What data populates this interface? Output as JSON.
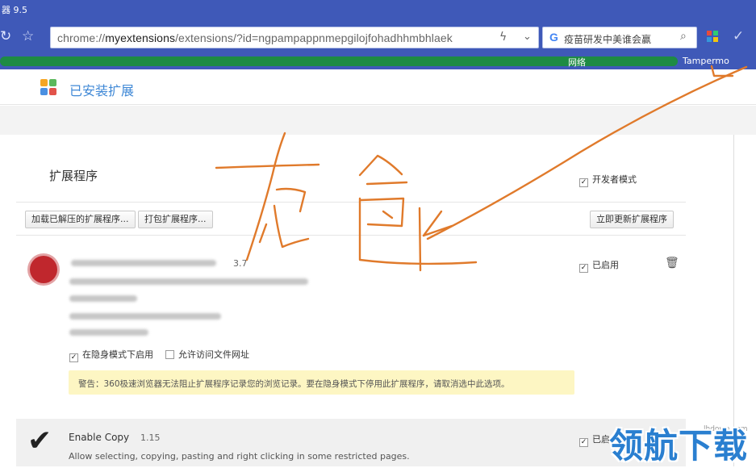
{
  "window": {
    "title": "器 9.5"
  },
  "toolbar": {
    "url_prefix": "chrome://",
    "url_host": "myextensions",
    "url_rest": "/extensions/?id=ngpampappnmepgilojfohadhhmbhlaek",
    "search_engine": "G",
    "search_text": "疫苗研发中美谁会赢"
  },
  "bookmarks": {
    "item_mid": "网络",
    "item_right": "Tampermo"
  },
  "page": {
    "title": "已安装扩展"
  },
  "extensions_panel": {
    "heading": "扩展程序",
    "developer_mode_label": "开发者模式",
    "developer_mode_checked": true,
    "buttons": {
      "load_unpacked": "加载已解压的扩展程序...",
      "pack": "打包扩展程序...",
      "update_now": "立即更新扩展程序"
    }
  },
  "extensions": [
    {
      "version": "3.7",
      "enabled_label": "已启用",
      "enabled": true,
      "incognito_label": "在隐身模式下启用",
      "incognito_checked": true,
      "file_access_label": "允许访问文件网址",
      "file_access_checked": false,
      "warning": "警告：360极速浏览器无法阻止扩展程序记录您的浏览记录。要在隐身模式下停用此扩展程序，请取消选中此选项。"
    },
    {
      "name": "Enable Copy",
      "version": "1.15",
      "description": "Allow selecting, copying, pasting and right clicking in some restricted pages.",
      "enabled_label": "已启用",
      "enabled": true
    }
  ],
  "annotation": {
    "color": "#e07a2b"
  },
  "watermark": {
    "text": "领航下载",
    "url": "lhdown.com"
  },
  "colors": {
    "chrome_blue": "#3f59b8",
    "title_blue": "#3f88d6",
    "warning_bg": "#fdf6c3"
  }
}
